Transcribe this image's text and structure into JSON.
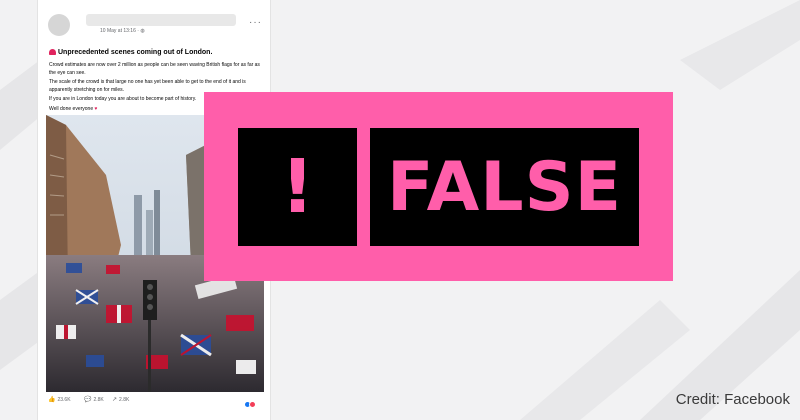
{
  "post": {
    "date": "10 May at 13:16 · ",
    "menu": "···",
    "title": "Unprecedented scenes coming out of London.",
    "paragraphs": [
      "Crowd estimates are now over 2 million as people can be seen waving British flags for as far as the eye can see.",
      "The scale of the crowd is that large no one has yet been able to get to the end of it and is apparently stretching on for miles.",
      "If you are in London today you are about to become part of history.",
      "Well done everyone"
    ],
    "stats": {
      "likes": "23.6K",
      "comments": "2.8K",
      "shares": "2.8K"
    }
  },
  "rating": {
    "exclaim": "!",
    "label": "FALSE",
    "color": "#ff5eaa"
  },
  "credit": "Credit: Facebook",
  "icons": [
    "siren-icon",
    "heart-icon",
    "globe-icon",
    "like-icon",
    "comment-icon",
    "share-icon"
  ]
}
